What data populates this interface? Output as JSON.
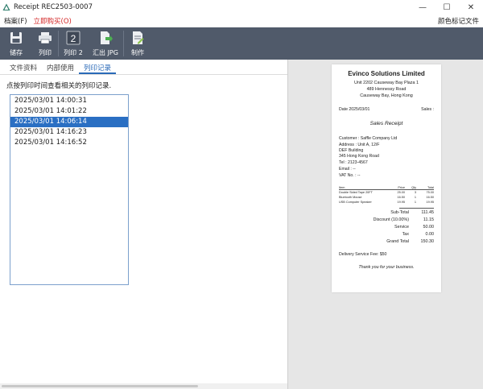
{
  "window": {
    "title": "Receipt REC2503-0007",
    "minimize": "—",
    "maximize": "☐",
    "close": "✕"
  },
  "menu": {
    "file": "档案(F)",
    "buy": "立即购买(O)",
    "right": "颜色标记文件"
  },
  "toolbar": {
    "save": "储存",
    "print": "列印",
    "print2": "列印 2",
    "print2_glyph": "2",
    "export_jpg": "汇出 JPG",
    "make": "制作"
  },
  "tabs": [
    "文件资料",
    "内部使用",
    "列印记录"
  ],
  "hint": "点按列印时间查看相关的列印记录.",
  "print_log": [
    "2025/03/01 14:00:31",
    "2025/03/01 14:01:22",
    "2025/03/01 14:06:14",
    "2025/03/01 14:16:23",
    "2025/03/01 14:16:52"
  ],
  "receipt": {
    "company": "Evinco Solutions Limited",
    "addr1": "Unit 2202 Causeway Bay Plaza 1",
    "addr2": "489 Hennessy Road",
    "addr3": "Causeway Bay, Hong Kong",
    "date": "Date 2025/03/01",
    "sales": "Sales :",
    "title": "Sales Receipt",
    "customer": "Customer : Saffle Company Ltd",
    "address": "Address : Unit A, 12/F",
    "address2": "DEF Building",
    "address3": "345 Hong Kong Road",
    "tel": "Tel : 2123-4567",
    "email": "Email : --",
    "vat": "VAT No. : --",
    "head": {
      "item": "Item",
      "price": "Price",
      "qty": "Qty",
      "total": "Total"
    },
    "rows": [
      {
        "item": "Double Sided Tape 20FT",
        "price": "25.00",
        "qty": "3",
        "total": "75.00"
      },
      {
        "item": "Bluetooth Mouse",
        "price": "16.50",
        "qty": "1",
        "total": "16.50"
      },
      {
        "item": "USB Computer Speaker",
        "price": "19.95",
        "qty": "1",
        "total": "19.95"
      }
    ],
    "subtotal_label": "Sub-Total",
    "subtotal": "111.45",
    "discount_label": "Discount (10.00%)",
    "discount": "11.15",
    "service_label": "Service",
    "service": "50.00",
    "tax_label": "Tax",
    "tax": "0.00",
    "grand_label": "Grand Total",
    "grand": "150.30",
    "delivery": "Delivery Service Fee: $50",
    "thanks": "Thank you for your business."
  }
}
